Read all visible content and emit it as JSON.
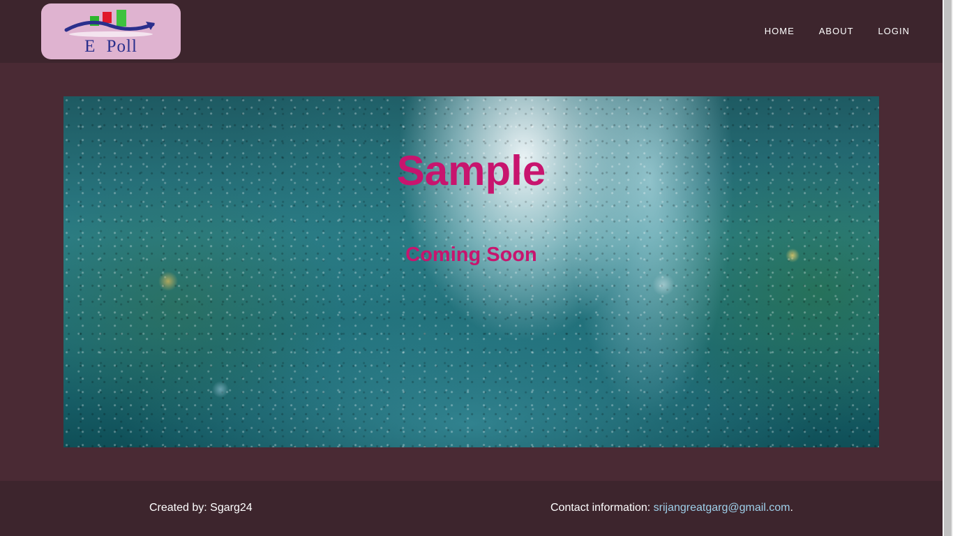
{
  "header": {
    "logo_text": "E Poll",
    "nav": [
      {
        "label": "HOME"
      },
      {
        "label": "ABOUT"
      },
      {
        "label": "LOGIN"
      }
    ]
  },
  "hero": {
    "title": "Sample",
    "subtitle": "Coming Soon"
  },
  "footer": {
    "created_text": "Created by: Sgarg24",
    "contact_label": "Contact information: ",
    "contact_email": "srijangreatgarg@gmail.com",
    "contact_suffix": "."
  },
  "colors": {
    "navbar_bg": "#3d252d",
    "page_bg": "#4a2a34",
    "accent_pink": "#c8146e",
    "logo_bg": "#dfb3d0",
    "link_color": "#9fd0ea"
  }
}
